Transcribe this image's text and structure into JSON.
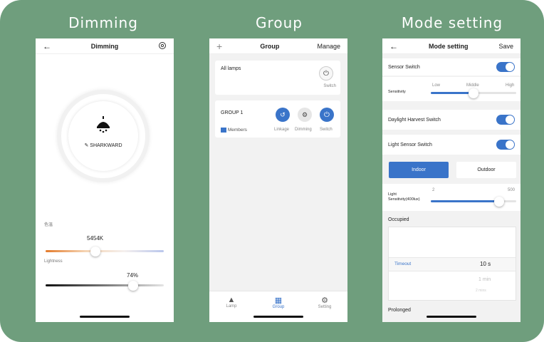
{
  "titles": {
    "dimming": "Dimming",
    "group": "Group",
    "mode": "Mode setting"
  },
  "dimming": {
    "header_title": "Dimming",
    "lamp_name": "SHARKWARD",
    "color_temp_label": "色温",
    "color_temp_value": "5454K",
    "color_temp_level": 0.42,
    "lightness_label": "Lightness",
    "lightness_value": "74%",
    "lightness_level": 0.74
  },
  "group": {
    "header_title": "Group",
    "manage_label": "Manage",
    "all_lamps_label": "All lamps",
    "switch_label": "Switch",
    "group1_name": "GROUP 1",
    "members_label": "Members",
    "linkage_label": "Linkage",
    "dimming_label": "Dimming",
    "switch2_label": "Switch",
    "nav_lamp": "Lamp",
    "nav_group": "Group",
    "nav_setting": "Setting"
  },
  "mode": {
    "header_title": "Mode setting",
    "save_label": "Save",
    "sensor_switch_label": "Sensor Switch",
    "sensitivity_label": "Sensitivity",
    "low_label": "Low",
    "middle_label": "Middle",
    "high_label": "High",
    "sensitivity_level": 0.5,
    "daylight_label": "Daylight Harvest Switch",
    "light_sensor_label": "Light Sensor Switch",
    "indoor_label": "Indoor",
    "outdoor_label": "Outdoor",
    "light_sens_label_1": "Light",
    "light_sens_label_2": "Sensitivity(400lux)",
    "light_min": "2",
    "light_max": "500",
    "light_level": 0.8,
    "occupied_label": "Occupied",
    "timeout_label": "Timeout",
    "timeout_value": "10 s",
    "timeout_next": "1 min",
    "timeout_next2": "2 mins",
    "prolonged_label": "Prolonged"
  },
  "colors": {
    "accent": "#3a74c9",
    "frame": "#6f9e7d"
  }
}
